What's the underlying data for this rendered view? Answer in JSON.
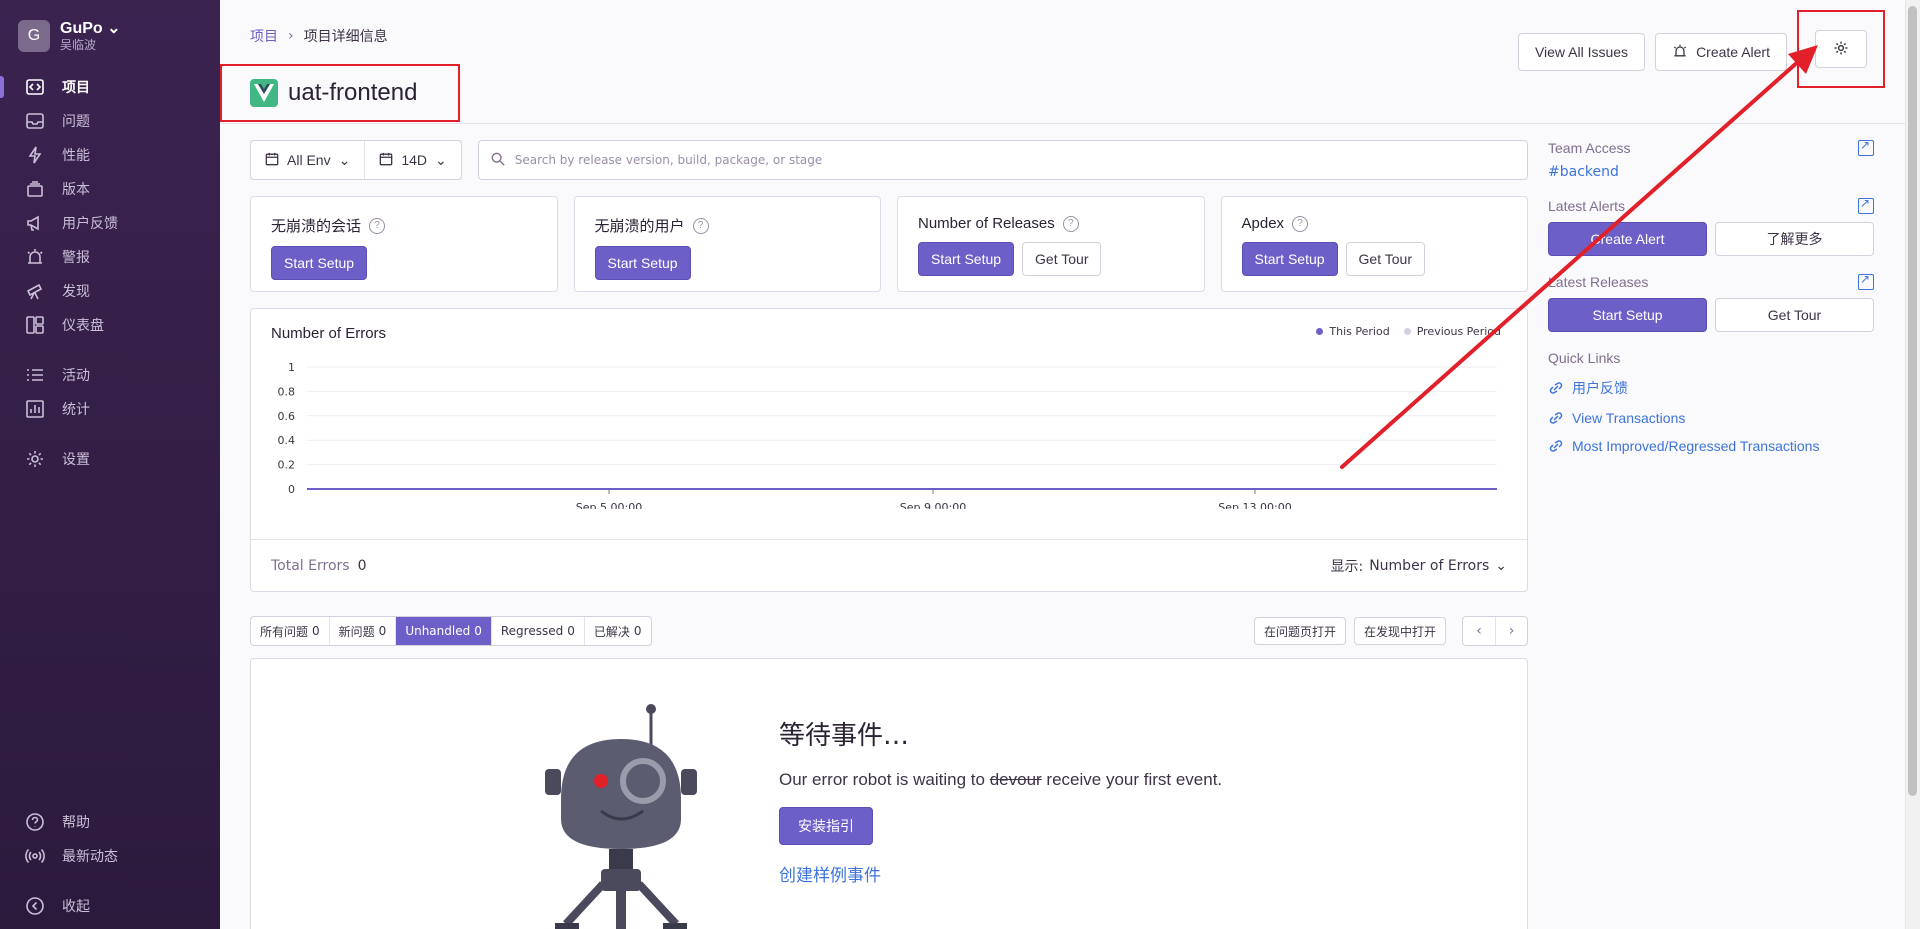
{
  "org": {
    "avatar_letter": "G",
    "name": "GuPo",
    "user": "吴临波"
  },
  "sidebar": {
    "items": [
      {
        "label": "项目",
        "icon": "code-icon",
        "active": true
      },
      {
        "label": "问题",
        "icon": "inbox-icon"
      },
      {
        "label": "性能",
        "icon": "lightning-icon"
      },
      {
        "label": "版本",
        "icon": "stack-icon"
      },
      {
        "label": "用户反馈",
        "icon": "megaphone-icon"
      },
      {
        "label": "警报",
        "icon": "siren-icon"
      },
      {
        "label": "发现",
        "icon": "telescope-icon"
      },
      {
        "label": "仪表盘",
        "icon": "dashboard-icon"
      },
      {
        "label": "活动",
        "icon": "list-icon"
      },
      {
        "label": "统计",
        "icon": "graph-icon"
      },
      {
        "label": "设置",
        "icon": "gear-icon"
      }
    ],
    "bottom": [
      {
        "label": "帮助",
        "icon": "question-icon"
      },
      {
        "label": "最新动态",
        "icon": "broadcast-icon"
      },
      {
        "label": "收起",
        "icon": "collapse-icon"
      }
    ]
  },
  "header": {
    "breadcrumb": [
      "项目",
      "项目详细信息"
    ],
    "project_name": "uat-frontend",
    "buttons": {
      "view_issues": "View All Issues",
      "create_alert": "Create Alert"
    }
  },
  "filters": {
    "env": "All Env",
    "period": "14D",
    "search_placeholder": "Search by release version, build, package, or stage"
  },
  "cards": [
    {
      "title": "无崩溃的会话",
      "buttons": [
        "Start Setup"
      ]
    },
    {
      "title": "无崩溃的用户",
      "buttons": [
        "Start Setup"
      ]
    },
    {
      "title": "Number of Releases",
      "buttons": [
        "Start Setup",
        "Get Tour"
      ]
    },
    {
      "title": "Apdex",
      "buttons": [
        "Start Setup",
        "Get Tour"
      ]
    }
  ],
  "chart_data": {
    "type": "line",
    "title": "Number of Errors",
    "series": [
      {
        "name": "This Period",
        "color": "#6c5fc7",
        "values": [
          0,
          0,
          0,
          0,
          0,
          0,
          0,
          0,
          0,
          0,
          0,
          0,
          0,
          0
        ]
      },
      {
        "name": "Previous Period",
        "color": "#d6d0dc",
        "values": [
          0,
          0,
          0,
          0,
          0,
          0,
          0,
          0,
          0,
          0,
          0,
          0,
          0,
          0
        ]
      }
    ],
    "y_ticks": [
      "1",
      "0.8",
      "0.6",
      "0.4",
      "0.2",
      "0"
    ],
    "x_ticks": [
      "Sep 5 00:00",
      "Sep 9 00:00",
      "Sep 13 00:00"
    ],
    "ylim": [
      0,
      1
    ],
    "legend": "top-right",
    "grid": true
  },
  "chart_footer": {
    "total_label": "Total Errors",
    "total_value": "0",
    "display_label": "显示:",
    "display_value": "Number of Errors"
  },
  "issue_tabs": [
    {
      "label": "所有问题",
      "count": "0"
    },
    {
      "label": "新问题",
      "count": "0"
    },
    {
      "label": "Unhandled",
      "count": "0",
      "active": true
    },
    {
      "label": "Regressed",
      "count": "0"
    },
    {
      "label": "已解决",
      "count": "0"
    }
  ],
  "issue_actions": {
    "open_issues": "在问题页打开",
    "open_discover": "在发现中打开"
  },
  "empty": {
    "title": "等待事件…",
    "desc_before": "Our error robot is waiting to",
    "desc_strike": "devour",
    "desc_after": "receive your first event.",
    "install_btn": "安装指引",
    "sample_link": "创建样例事件"
  },
  "right": {
    "team_access": {
      "title": "Team Access",
      "link": "#backend"
    },
    "latest_alerts": {
      "title": "Latest Alerts",
      "primary": "Create Alert",
      "secondary": "了解更多"
    },
    "latest_releases": {
      "title": "Latest Releases",
      "primary": "Start Setup",
      "secondary": "Get Tour"
    },
    "quick_links": {
      "title": "Quick Links",
      "links": [
        "用户反馈",
        "View Transactions",
        "Most Improved/Regressed Transactions"
      ]
    }
  },
  "colors": {
    "sidebar": "#3b2350",
    "accent": "#6c5fc7",
    "link": "#3d74db",
    "annotation": "#e2202a"
  }
}
